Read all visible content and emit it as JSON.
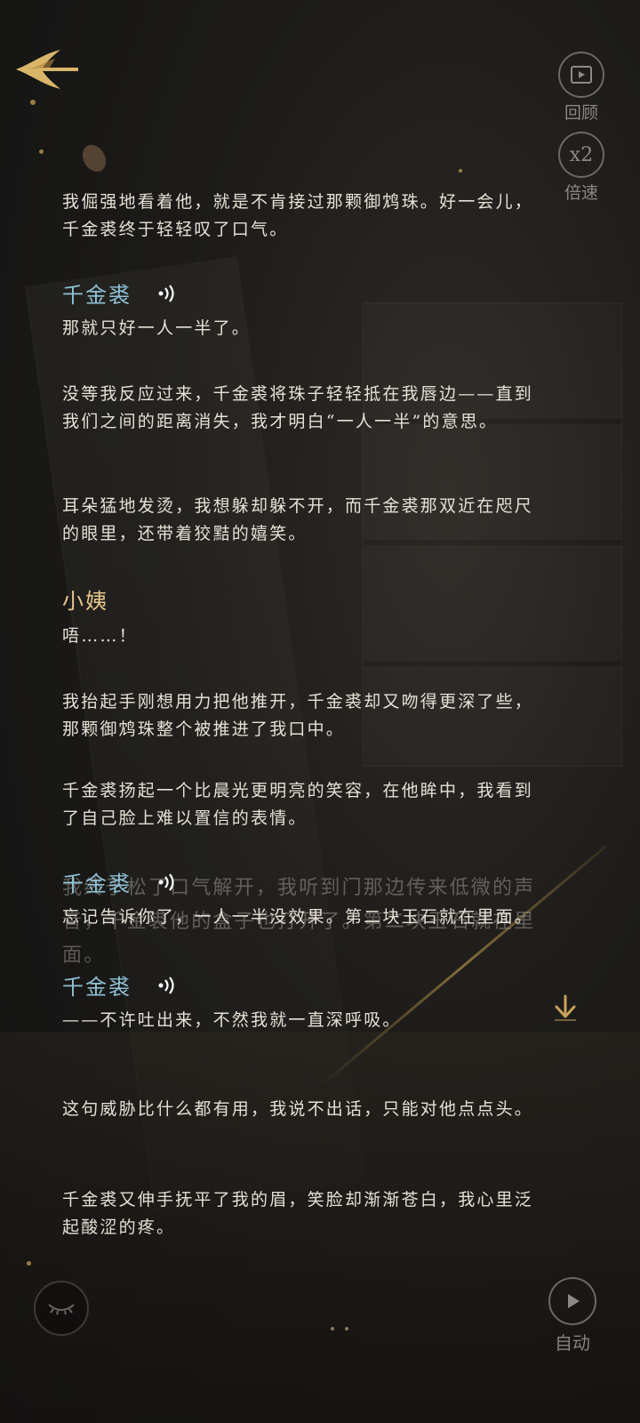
{
  "controls": {
    "review_label": "回顾",
    "speed_value": "x2",
    "speed_label": "倍速",
    "auto_label": "自动"
  },
  "dialogue": {
    "narration_1": "我倔强地看着他，就是不肯接过那颗御鸩珠。好一会儿，千金裘终于轻轻叹了口气。",
    "speaker_1": "千金裘",
    "line_1": "那就只好一人一半了。",
    "narration_2": "没等我反应过来，千金裘将珠子轻轻抵在我唇边——直到我们之间的距离消失，我才明白“一人一半”的意思。",
    "narration_3": "耳朵猛地发烫，我想躲却躲不开，而千金裘那双近在咫尺的眼里，还带着狡黠的嬉笑。",
    "speaker_2": "小姨",
    "line_2": "唔……！",
    "narration_4": "我抬起手刚想用力把他推开，千金裘却又吻得更深了些，那颗御鸩珠整个被推进了我口中。",
    "narration_5": "千金裘扬起一个比晨光更明亮的笑容，在他眸中，我看到了自己脸上难以置信的表情。",
    "ghost_narration": "我终于松了口气解开，我听到门那边传来低微的声音，千金裘他的盒子也打开了。第二块玉石就在里面。",
    "speaker_3": "千金裘",
    "line_3": "忘记告诉你了，一人一半没效果。第二块玉石就在里面。",
    "speaker_4": "千金裘",
    "line_4": "——不许吐出来，不然我就一直深呼吸。",
    "narration_6": "这句威胁比什么都有用，我说不出话，只能对他点点头。",
    "narration_7": "千金裘又伸手抚平了我的眉，笑脸却渐渐苍白，我心里泛起酸涩的疼。"
  },
  "colors": {
    "speaker_blue": "#8fc2d6",
    "speaker_gold": "#e8c98e",
    "accent_gold": "#c9a35a"
  },
  "icons": [
    "back-arrow-icon",
    "review-icon",
    "voice-icon",
    "scroll-down-icon",
    "eye-closed-icon",
    "auto-play-icon"
  ]
}
